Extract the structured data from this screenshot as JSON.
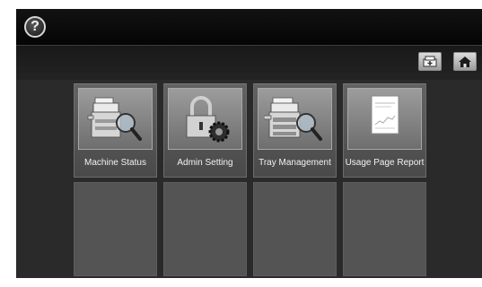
{
  "topbar": {
    "help_icon": "question-circle-icon",
    "help_label": "?"
  },
  "toolbar": {
    "tray_icon": "tray-icon",
    "home_icon": "home-icon"
  },
  "menu": {
    "items": [
      {
        "label": "Machine Status",
        "icon": "machine-status-icon"
      },
      {
        "label": "Admin Setting",
        "icon": "admin-lock-gear-icon"
      },
      {
        "label": "Tray Management",
        "icon": "tray-management-icon"
      },
      {
        "label": "Usage Page Report",
        "icon": "report-page-icon"
      }
    ]
  },
  "colors": {
    "background": "#2a2a2a",
    "tile": "#555555",
    "label_text": "#f2f2f2"
  }
}
